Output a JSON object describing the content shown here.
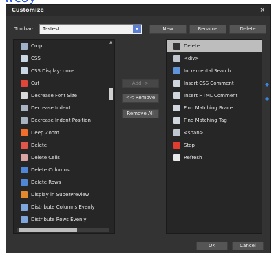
{
  "fragment_top": "wcoy",
  "window": {
    "title": "Customize",
    "close_glyph": "×"
  },
  "toolbar": {
    "label": "Toolbar:",
    "selected": "Tastest",
    "dropdown_glyph": "▾",
    "buttons": [
      "New",
      "Rename",
      "Delete"
    ]
  },
  "middle_buttons": {
    "add": "Add ->",
    "remove": "<< Remove",
    "remove_all": "Remove All"
  },
  "available_commands": [
    {
      "label": "Crop",
      "icon": "crop-icon",
      "color": "#9fb2c7"
    },
    {
      "label": "CSS",
      "icon": "css-icon",
      "color": "#c9d6e4"
    },
    {
      "label": "CSS Display: none",
      "icon": "css-display-icon",
      "color": "#c9d6e4"
    },
    {
      "label": "Cut",
      "icon": "scissors-icon",
      "color": "#e0453a"
    },
    {
      "label": "Decrease Font Size",
      "icon": "font-size-icon",
      "color": "#d8d8d8"
    },
    {
      "label": "Decrease Indent",
      "icon": "outdent-icon",
      "color": "#a8b4c2"
    },
    {
      "label": "Decrease Indent Position",
      "icon": "indent-position-icon",
      "color": "#a8b4c2"
    },
    {
      "label": "Deep Zoom...",
      "icon": "zoom-icon",
      "color": "#f06d2a"
    },
    {
      "label": "Delete",
      "icon": "delete-icon",
      "color": "#e2564a"
    },
    {
      "label": "Delete Cells",
      "icon": "table-cells-icon",
      "color": "#d8a3a3"
    },
    {
      "label": "Delete Columns",
      "icon": "table-columns-icon",
      "color": "#4f86d8"
    },
    {
      "label": "Delete Rows",
      "icon": "table-rows-icon",
      "color": "#4f86d8"
    },
    {
      "label": "Display in SuperPreview",
      "icon": "superpreview-icon",
      "color": "#e4872d"
    },
    {
      "label": "Distribute Columns Evenly",
      "icon": "columns-even-icon",
      "color": "#7ea6dc"
    },
    {
      "label": "Distribute Rows Evenly",
      "icon": "rows-even-icon",
      "color": "#7ea6dc"
    }
  ],
  "toolbar_commands": [
    {
      "label": "Delete",
      "icon": "x-icon",
      "color": "#333333",
      "selected": true
    },
    {
      "label": "<div>",
      "icon": "div-icon",
      "color": "#bfc6cf",
      "selected": false
    },
    {
      "label": "Incremental Search",
      "icon": "search-icon",
      "color": "#5f93db",
      "selected": false
    },
    {
      "label": "Insert CSS Comment",
      "icon": "css-comment-icon",
      "color": "#cfd6de",
      "selected": false
    },
    {
      "label": "Insert HTML Comment",
      "icon": "html-comment-icon",
      "color": "#cfd6de",
      "selected": false
    },
    {
      "label": "Find Matching Brace",
      "icon": "brace-icon",
      "color": "#cfd6de",
      "selected": false
    },
    {
      "label": "Find Matching Tag",
      "icon": "tag-icon",
      "color": "#cfd6de",
      "selected": false
    },
    {
      "label": "<span>",
      "icon": "span-icon",
      "color": "#bfc6cf",
      "selected": false
    },
    {
      "label": "Stop",
      "icon": "stop-icon",
      "color": "#e23c30",
      "selected": false
    },
    {
      "label": "Refresh",
      "icon": "refresh-icon",
      "color": "#e9e9e9",
      "selected": false
    }
  ],
  "footer": {
    "ok": "OK",
    "cancel": "Cancel"
  },
  "colors": {
    "dialog_bg": "#333333",
    "list_bg": "#262626",
    "accent": "#5b7fd6"
  }
}
